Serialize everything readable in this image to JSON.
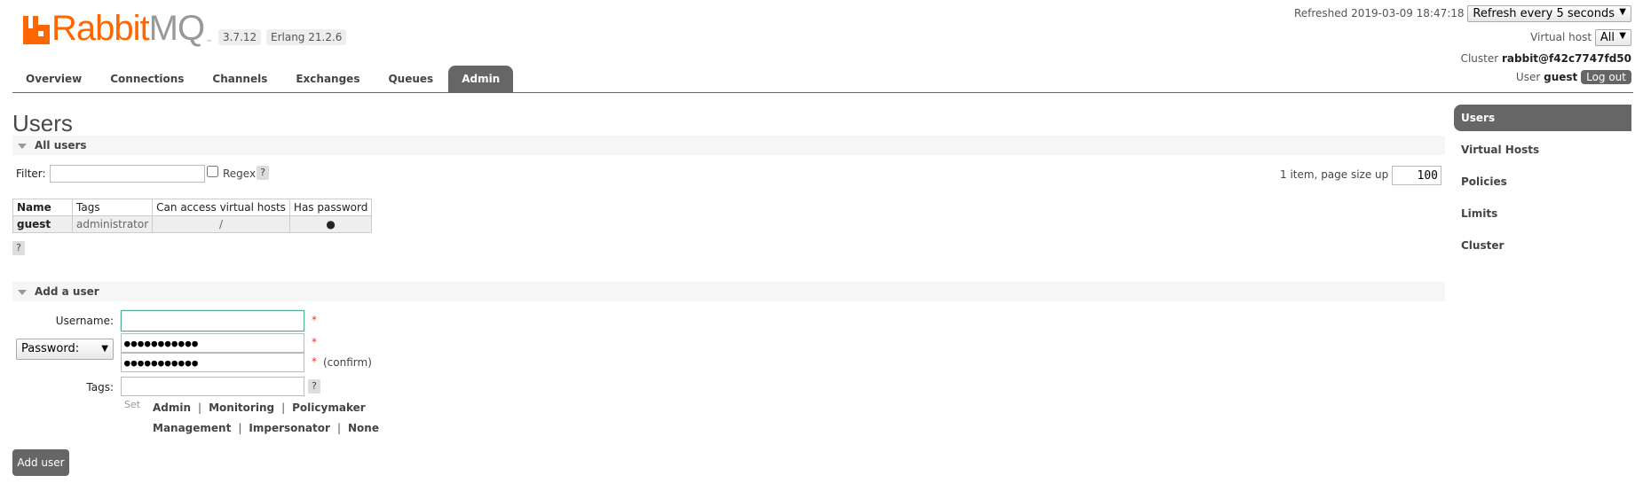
{
  "brand": {
    "name_part1": "Rabbit",
    "name_part2": "MQ",
    "tm": "™",
    "color": "#ff6600"
  },
  "versions": {
    "rabbitmq": "3.7.12",
    "erlang": "Erlang 21.2.6"
  },
  "header": {
    "refreshed": "Refreshed 2019-03-09 18:47:18",
    "refresh_select": "Refresh every 5 seconds",
    "vhost_label": "Virtual host",
    "vhost_select": "All",
    "cluster_label": "Cluster",
    "cluster_name": "rabbit@f42c7747fd50",
    "user_label": "User",
    "user_name": "guest",
    "logout": "Log out"
  },
  "tabs": [
    {
      "label": "Overview"
    },
    {
      "label": "Connections"
    },
    {
      "label": "Channels"
    },
    {
      "label": "Exchanges"
    },
    {
      "label": "Queues"
    },
    {
      "label": "Admin",
      "active": true
    }
  ],
  "page_title": "Users",
  "all_users": {
    "heading": "All users",
    "filter_label": "Filter:",
    "regex_label": "Regex",
    "help": "?",
    "page_info": "1 item, page size up to",
    "page_size": "100",
    "columns": [
      "Name",
      "Tags",
      "Can access virtual hosts",
      "Has password"
    ],
    "rows": [
      {
        "name": "guest",
        "tags": "administrator",
        "vhosts": "/",
        "has_password": "●"
      }
    ]
  },
  "add_user": {
    "heading": "Add a user",
    "username_label": "Username:",
    "password_select": "Password:",
    "password_value": "●●●●●●●●●●●",
    "confirm_value": "●●●●●●●●●●●",
    "confirm_label": "(confirm)",
    "tags_label": "Tags:",
    "required": "*",
    "set_label": "Set",
    "tag_options_row1": [
      "Admin",
      "Monitoring",
      "Policymaker"
    ],
    "tag_options_row2": [
      "Management",
      "Impersonator",
      "None"
    ],
    "separator": "|",
    "submit": "Add user"
  },
  "side_nav": [
    {
      "label": "Users",
      "active": true
    },
    {
      "label": "Virtual Hosts"
    },
    {
      "label": "Policies"
    },
    {
      "label": "Limits"
    },
    {
      "label": "Cluster"
    }
  ]
}
